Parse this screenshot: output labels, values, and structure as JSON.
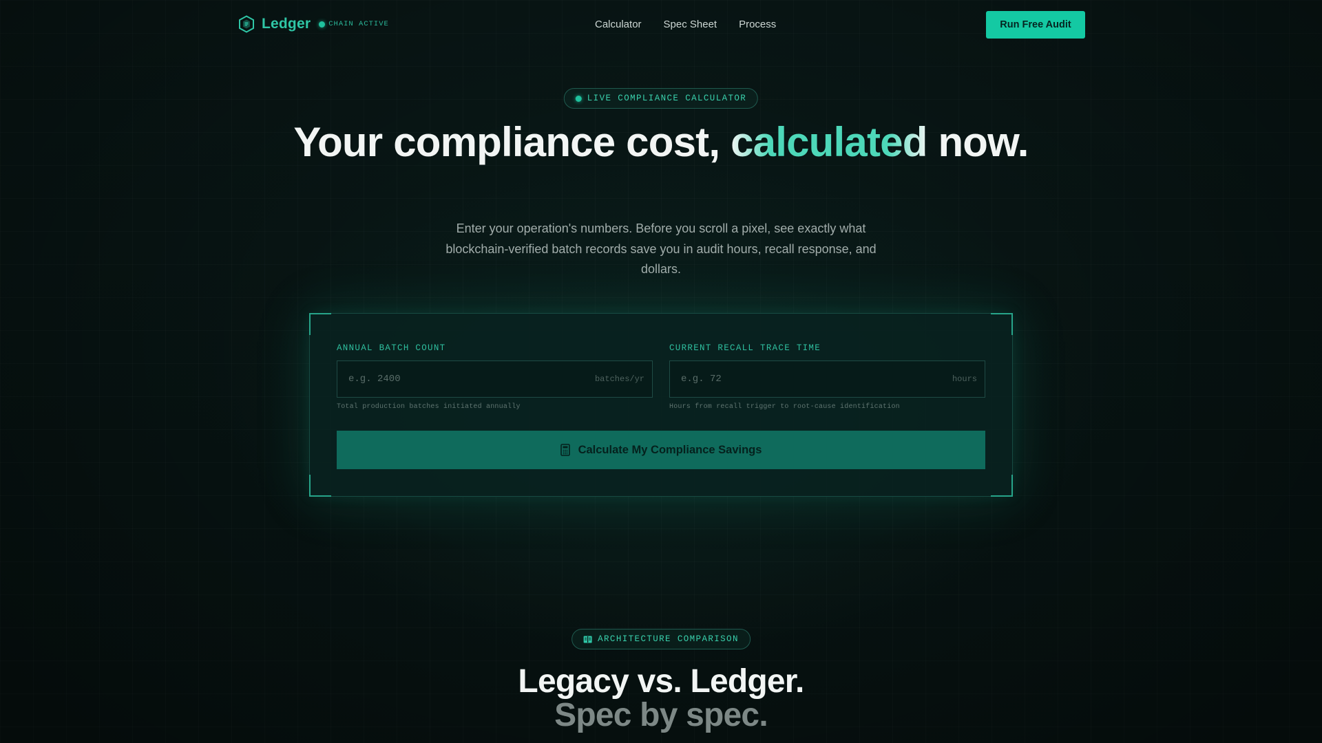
{
  "nav": {
    "brand": "Ledger",
    "status_badge": "CHAIN ACTIVE",
    "links": [
      "Calculator",
      "Spec Sheet",
      "Process"
    ],
    "cta": "Run Free Audit"
  },
  "hero": {
    "badge": "LIVE COMPLIANCE CALCULATOR",
    "title_before": "Your compliance cost, ",
    "title_accent": "calculated",
    "title_after": " now.",
    "subtitle": "Enter your operation's numbers. Before you scroll a pixel, see exactly what blockchain-verified batch records save you in audit hours, recall response, and dollars."
  },
  "calculator": {
    "fields": [
      {
        "label": "ANNUAL BATCH COUNT",
        "placeholder": "e.g. 2400",
        "value": "",
        "unit": "batches/yr",
        "help": "Total production batches initiated annually"
      },
      {
        "label": "CURRENT RECALL TRACE TIME",
        "placeholder": "e.g. 72",
        "value": "",
        "unit": "hours",
        "help": "Hours from recall trigger to root-cause identification"
      }
    ],
    "submit": "Calculate My Compliance Savings",
    "submit_icon": "calculator-icon"
  },
  "comparison": {
    "badge": "ARCHITECTURE COMPARISON",
    "badge_icon": "columns-icon",
    "title_line1": "Legacy vs. Ledger.",
    "title_line2": "Spec by spec."
  },
  "colors": {
    "background": "#071312",
    "accent": "#14c9a3",
    "accent_text": "#2fc6a6",
    "button_dark": "#0f6b5c"
  }
}
